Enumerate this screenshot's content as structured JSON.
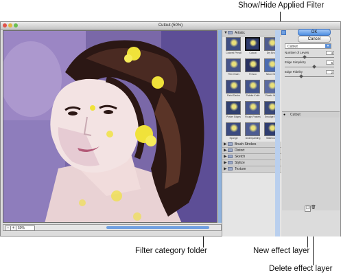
{
  "callouts": {
    "show_hide": "Show/Hide Applied Filter",
    "category_folder": "Filter category folder",
    "new_layer": "New effect layer",
    "delete_layer": "Delete effect layer"
  },
  "dialog": {
    "title": "Cutout (50%)",
    "zoom": "50%",
    "ok_label": "OK",
    "cancel_label": "Cancel"
  },
  "gallery": {
    "open_folder": "Artistic",
    "thumbs": [
      {
        "label": "Colored Pencil",
        "color": "#3f4f83"
      },
      {
        "label": "Cutout",
        "color": "#2d3a6b"
      },
      {
        "label": "Dry Brush",
        "color": "#505d8f"
      },
      {
        "label": "Film Grain",
        "color": "#47558a"
      },
      {
        "label": "Fresco",
        "color": "#2a3260"
      },
      {
        "label": "Neon Glow",
        "color": "#4b6bb0"
      },
      {
        "label": "Paint Daubs",
        "color": "#3c4a7e"
      },
      {
        "label": "Palette Knife",
        "color": "#43548c"
      },
      {
        "label": "Plastic Wrap",
        "color": "#5a6aa0"
      },
      {
        "label": "Poster Edges",
        "color": "#30406f"
      },
      {
        "label": "Rough Pastels",
        "color": "#46568e"
      },
      {
        "label": "Smudge Stick",
        "color": "#394878"
      },
      {
        "label": "Sponge",
        "color": "#3a4a80"
      },
      {
        "label": "Underpainting",
        "color": "#4d5c92"
      },
      {
        "label": "Watercolor",
        "color": "#2f3d70"
      }
    ],
    "folders": [
      "Brush Strokes",
      "Distort",
      "Sketch",
      "Stylize",
      "Texture"
    ]
  },
  "settings": {
    "filter": "Cutout",
    "params": [
      {
        "label": "Number of Levels",
        "value": "4",
        "fraction": 0.4
      },
      {
        "label": "Edge Simplicity",
        "value": "6",
        "fraction": 0.6
      },
      {
        "label": "Edge Fidelity",
        "value": "2",
        "fraction": 0.33
      }
    ]
  },
  "layers": {
    "current": "Cutout"
  }
}
